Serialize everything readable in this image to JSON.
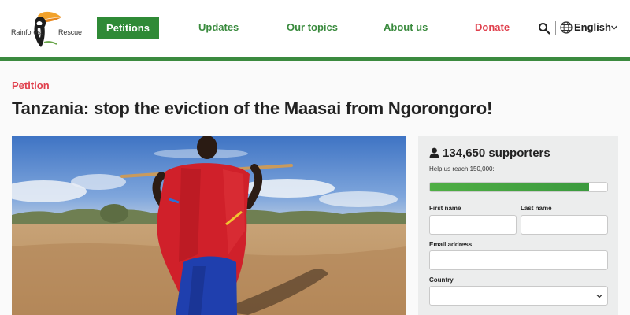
{
  "header": {
    "logo": {
      "word1": "Rainforest",
      "word2": "Rescue"
    },
    "nav": {
      "petitions": "Petitions",
      "updates": "Updates",
      "topics": "Our topics",
      "about": "About us",
      "donate": "Donate"
    },
    "language": "English",
    "icons": [
      "toucan-logo",
      "search-icon",
      "globe-icon",
      "chevron-down-icon"
    ]
  },
  "main": {
    "kicker": "Petition",
    "title": "Tanzania: stop the eviction of the Maasai from Ngorongoro!"
  },
  "petition_form": {
    "supporters": "134,650 supporters",
    "goal_text": "Help us reach 150,000:",
    "progress_fraction": 0.8977,
    "fields": {
      "first_name_label": "First name",
      "last_name_label": "Last name",
      "email_label": "Email address",
      "country_label": "Country"
    }
  },
  "colors": {
    "brand_green": "#2f8a36",
    "accent_red": "#e0404d",
    "panel_bg": "#eceded"
  }
}
